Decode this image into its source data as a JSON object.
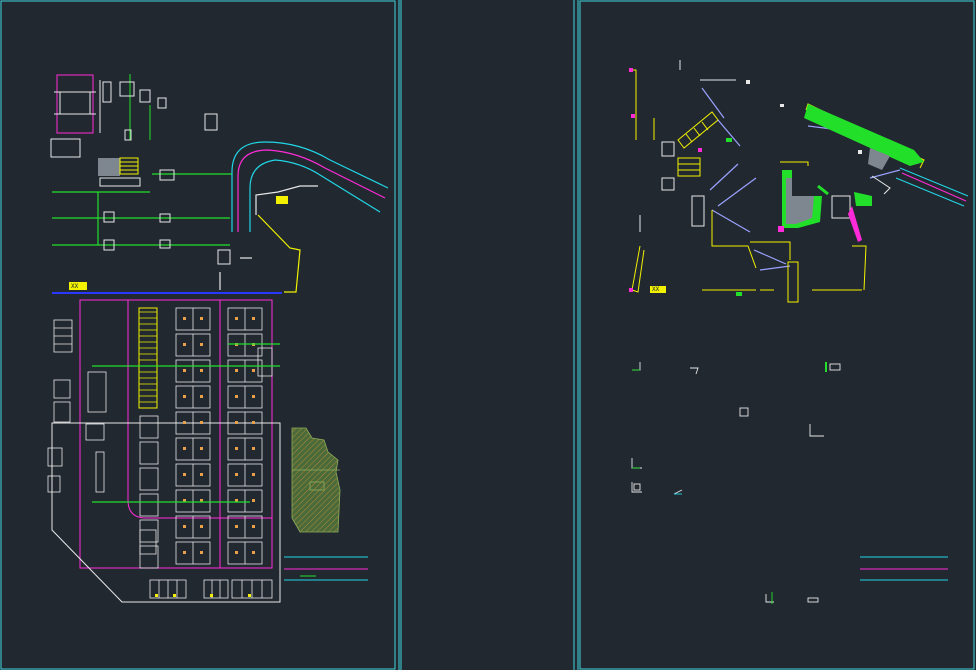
{
  "canvas": {
    "background": "#212830",
    "colors": {
      "frame": "#3fd3dc",
      "white": "#e8e8e8",
      "magenta": "#ff2bd8",
      "green": "#22e02a",
      "yellow": "#f2f200",
      "cyan": "#22d6e6",
      "blue": "#2a38ff",
      "lavender": "#9aa2ff",
      "gray": "#7e8790",
      "orange": "#e8a04a",
      "olive": "#8fae5a"
    }
  },
  "sheets": [
    {
      "id": "sheet-1",
      "content": "basement-parking-floor-plan"
    },
    {
      "id": "sheet-2",
      "content": "blank-drawing-frame"
    },
    {
      "id": "sheet-3",
      "content": "ground-floor-partial-plan"
    }
  ],
  "badges": {
    "sheet1": "XX",
    "sheet3": "XX"
  }
}
